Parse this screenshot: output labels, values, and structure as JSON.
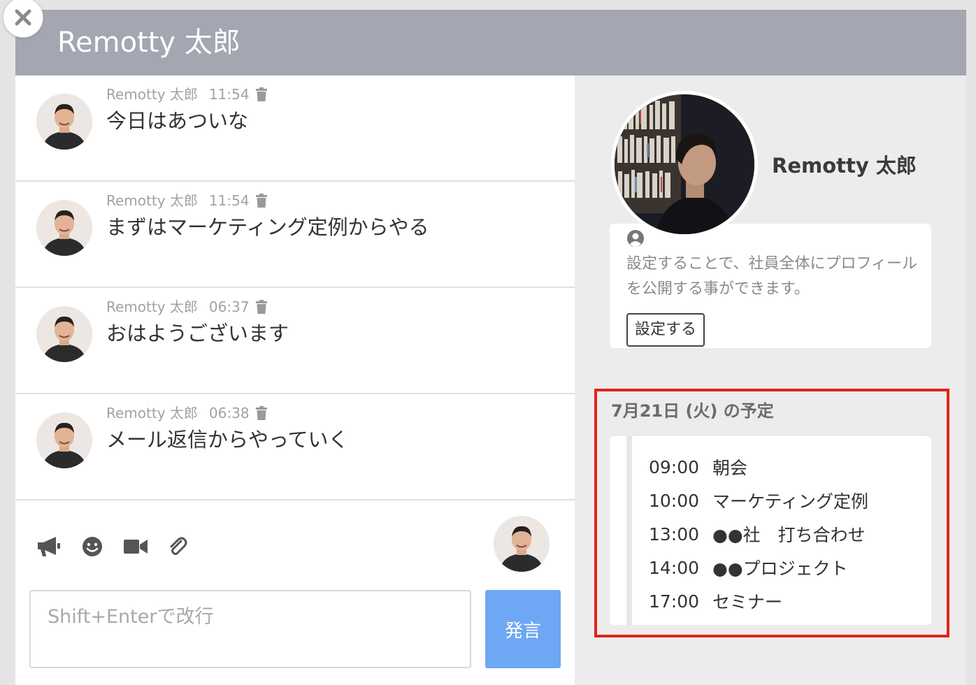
{
  "header": {
    "title": "Remotty 太郎"
  },
  "messages": [
    {
      "author": "Remotty 太郎",
      "time": "11:54",
      "text": "今日はあついな"
    },
    {
      "author": "Remotty 太郎",
      "time": "11:54",
      "text": "まずはマーケティング定例からやる"
    },
    {
      "author": "Remotty 太郎",
      "time": "06:37",
      "text": "おはようございます"
    },
    {
      "author": "Remotty 太郎",
      "time": "06:38",
      "text": "メール返信からやっていく"
    }
  ],
  "composer": {
    "placeholder": "Shift+Enterで改行",
    "send_label": "発言",
    "tools": [
      "megaphone-icon",
      "smiley-icon",
      "video-camera-icon",
      "paperclip-icon"
    ]
  },
  "profile": {
    "name": "Remotty 太郎",
    "description": "設定することで、社員全体にプロフィールを公開する事ができます。",
    "setup_label": "設定する"
  },
  "schedule": {
    "title": "7月21日 (火) の予定",
    "items": [
      {
        "time": "09:00",
        "title": "朝会"
      },
      {
        "time": "10:00",
        "title": "マーケティング定例"
      },
      {
        "time": "13:00",
        "title": "●●社　打ち合わせ"
      },
      {
        "time": "14:00",
        "title": "●●プロジェクト"
      },
      {
        "time": "17:00",
        "title": "セミナー"
      }
    ]
  },
  "colors": {
    "header_bg": "#a4a6b1",
    "send_button": "#6ea7f4",
    "highlight_border": "#e0241b",
    "sidebar_bg": "#ececec"
  }
}
